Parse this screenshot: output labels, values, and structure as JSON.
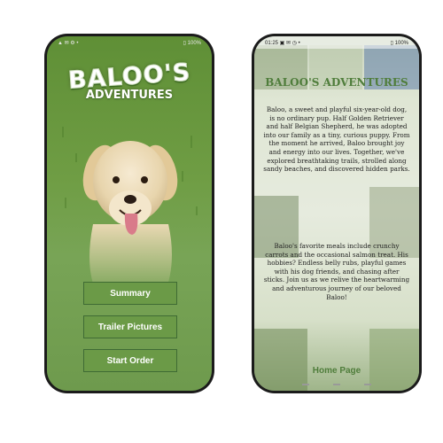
{
  "left_screen": {
    "status": {
      "left": "▲ ✉ ⚙ •",
      "right": "▯ 100%"
    },
    "logo": {
      "line1": "BALOO'S",
      "line2": "ADVENTURES"
    },
    "buttons": {
      "summary": "Summary",
      "trailer_pictures": "Trailer Pictures",
      "start_order": "Start Order"
    }
  },
  "right_screen": {
    "status": {
      "left": "01:25 ▣ ✉ ◷ •",
      "right": "▯ 100%"
    },
    "title": "BALOO'S ADVENTURES",
    "paragraph1": "Baloo, a sweet and playful six-year-old dog, is no ordinary pup. Half Golden Retriever and half Belgian Shepherd, he was adopted into our family as a tiny, curious puppy. From the moment he arrived, Baloo brought joy and energy into our lives. Together, we've explored breathtaking trails, strolled along sandy beaches, and discovered hidden parks.",
    "paragraph2": "Baloo's favorite meals include crunchy carrots and the occasional salmon treat. His hobbies? Endless belly rubs, playful games with his dog friends, and chasing after sticks. Join us as we relive the heartwarming and adventurous journey of our beloved Baloo!",
    "home_link": "Home Page"
  }
}
